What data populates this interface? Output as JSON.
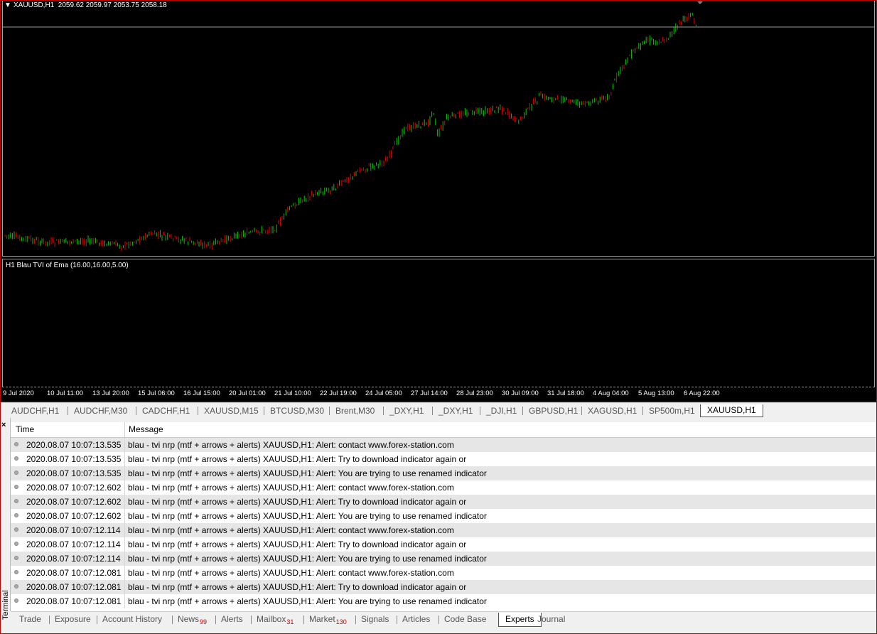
{
  "chart": {
    "symbol_info": "XAUUSD,H1  2059.62 2059.97 2053.75 2058.18",
    "indicator_label": "H1 Blau TVI of Ema (16.00,16.00,5.00)",
    "up_color": "#00c800",
    "down_color": "#e00000",
    "x_ticks": [
      "9 Jul 2020",
      "10 Jul 11:00",
      "13 Jul 20:00",
      "15 Jul 06:00",
      "16 Jul 15:00",
      "20 Jul 01:00",
      "21 Jul 10:00",
      "22 Jul 19:00",
      "24 Jul 05:00",
      "27 Jul 14:00",
      "28 Jul 23:00",
      "30 Jul 09:00",
      "31 Jul 18:00",
      "4 Aug 04:00",
      "5 Aug 13:00",
      "6 Aug 22:00"
    ]
  },
  "chart_tabs": [
    "AUDCHF,H1",
    "AUDCHF,M30",
    "CADCHF,H1",
    "XAUUSD,M15",
    "BTCUSD,M30",
    "Brent,M30",
    "_DXY,H1",
    "_DXY,H1",
    "_DJI,H1",
    "GBPUSD,H1",
    "XAGUSD,H1",
    "SP500m,H1",
    "XAUUSD,H1"
  ],
  "terminal": {
    "side_label": "Terminal",
    "close_glyph": "×",
    "columns": {
      "time": "Time",
      "message": "Message"
    },
    "rows": [
      {
        "time": "2020.08.07 10:07:13.535",
        "message": "blau - tvi nrp (mtf + arrows + alerts) XAUUSD,H1: Alert: contact www.forex-station.com"
      },
      {
        "time": "2020.08.07 10:07:13.535",
        "message": "blau - tvi nrp (mtf + arrows + alerts) XAUUSD,H1: Alert: Try to download indicator again or"
      },
      {
        "time": "2020.08.07 10:07:13.535",
        "message": "blau - tvi nrp (mtf + arrows + alerts) XAUUSD,H1: Alert: You are trying to use renamed indicator"
      },
      {
        "time": "2020.08.07 10:07:12.602",
        "message": "blau - tvi nrp (mtf + arrows + alerts) XAUUSD,H1: Alert: contact www.forex-station.com"
      },
      {
        "time": "2020.08.07 10:07:12.602",
        "message": "blau - tvi nrp (mtf + arrows + alerts) XAUUSD,H1: Alert: Try to download indicator again or"
      },
      {
        "time": "2020.08.07 10:07:12.602",
        "message": "blau - tvi nrp (mtf + arrows + alerts) XAUUSD,H1: Alert: You are trying to use renamed indicator"
      },
      {
        "time": "2020.08.07 10:07:12.114",
        "message": "blau - tvi nrp (mtf + arrows + alerts) XAUUSD,H1: Alert: contact www.forex-station.com"
      },
      {
        "time": "2020.08.07 10:07:12.114",
        "message": "blau - tvi nrp (mtf + arrows + alerts) XAUUSD,H1: Alert: Try to download indicator again or"
      },
      {
        "time": "2020.08.07 10:07:12.114",
        "message": "blau - tvi nrp (mtf + arrows + alerts) XAUUSD,H1: Alert: You are trying to use renamed indicator"
      },
      {
        "time": "2020.08.07 10:07:12.081",
        "message": "blau - tvi nrp (mtf + arrows + alerts) XAUUSD,H1: Alert: contact www.forex-station.com"
      },
      {
        "time": "2020.08.07 10:07:12.081",
        "message": "blau - tvi nrp (mtf + arrows + alerts) XAUUSD,H1: Alert: Try to download indicator again or"
      },
      {
        "time": "2020.08.07 10:07:12.081",
        "message": "blau - tvi nrp (mtf + arrows + alerts) XAUUSD,H1: Alert: You are trying to use renamed indicator"
      }
    ],
    "tabs": [
      {
        "label": "Trade"
      },
      {
        "label": "Exposure"
      },
      {
        "label": "Account History"
      },
      {
        "label": "News",
        "badge": "99"
      },
      {
        "label": "Alerts"
      },
      {
        "label": "Mailbox",
        "badge": "31"
      },
      {
        "label": "Market",
        "badge": "130"
      },
      {
        "label": "Signals"
      },
      {
        "label": "Articles"
      },
      {
        "label": "Code Base"
      },
      {
        "label": "Experts",
        "active": true
      },
      {
        "label": "Journal"
      }
    ]
  }
}
